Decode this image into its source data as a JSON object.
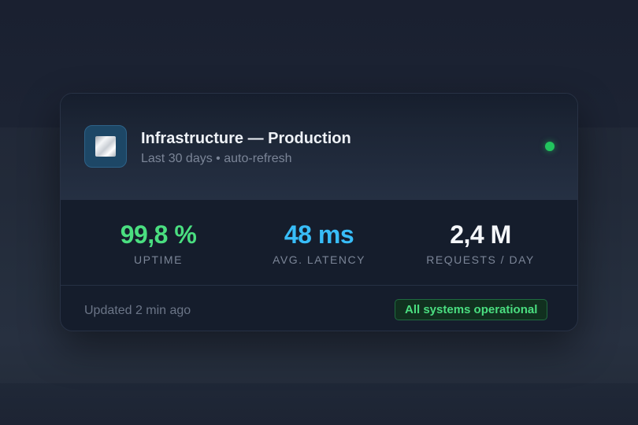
{
  "card": {
    "icon": "app-tile-icon",
    "title": "Infrastructure — Production",
    "subtitle": "Last 30 days • auto-refresh",
    "status_indicator_color": "#22c55e"
  },
  "stats": [
    {
      "value": "99,8 %",
      "label": "UPTIME",
      "color": "#4ade80"
    },
    {
      "value": "48 ms",
      "label": "AVG. LATENCY",
      "color": "#38bdf8"
    },
    {
      "value": "2,4 M",
      "label": "REQUESTS / DAY",
      "color": "#f5f7fa"
    }
  ],
  "footer": {
    "updated": "Updated 2 min ago",
    "badge": "All systems operational",
    "badge_color": "#4ade80"
  }
}
